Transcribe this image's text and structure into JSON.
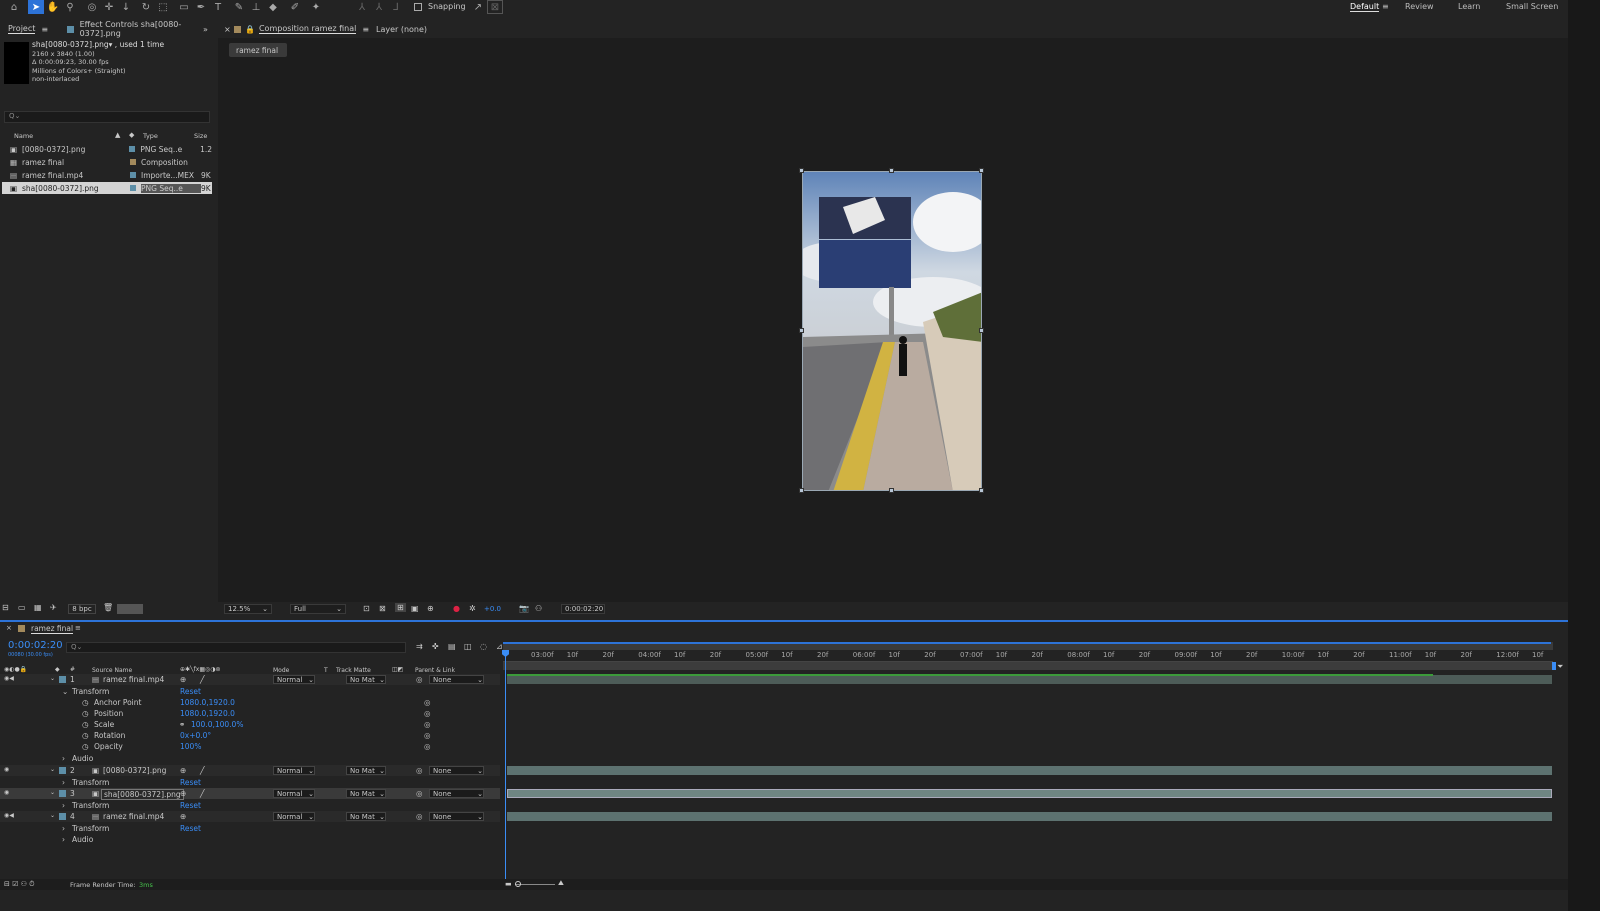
{
  "toolbar": {
    "snapping": "Snapping",
    "workspaces": [
      "Default",
      "Review",
      "Learn",
      "Small Screen"
    ]
  },
  "project_panel": {
    "tab_project": "Project",
    "tab_effect_controls": "Effect Controls sha[0080-0372].png",
    "info_name": "sha[0080-0372].png▾ , used 1 time",
    "info_size": "2160 x 3840 (1.00)",
    "info_dur": "Δ 0:00:09:23, 30.00 fps",
    "info_colors": "Millions of Colors+ (Straight)",
    "info_interlace": "non-interlaced",
    "search_placeholder": "Q⌄",
    "columns": {
      "name": "Name",
      "type": "Type",
      "size": "Size"
    },
    "items": [
      {
        "name": "[0080-0372].png",
        "type": "PNG Seq..e",
        "size": "1.2",
        "color": "#5d8fa8"
      },
      {
        "name": "ramez final",
        "type": "Composition",
        "size": "",
        "color": "#a38a5c"
      },
      {
        "name": "ramez final.mp4",
        "type": "Importe...MEX",
        "size": "9K",
        "color": "#5d8fa8"
      },
      {
        "name": "sha[0080-0372].png",
        "type": "PNG Seq..e",
        "size": "9K",
        "color": "#5d8fa8"
      }
    ],
    "bpc": "8 bpc"
  },
  "viewer": {
    "tab_comp": "Composition ramez final",
    "tab_layer": "Layer (none)",
    "comp_button": "ramez final",
    "zoom": "12.5%",
    "resolution": "Full",
    "exposure": "+0.0",
    "timecode": "0:00:02:20"
  },
  "timeline": {
    "tab": "ramez final",
    "timecode": "0:00:02:20",
    "timecode_sub": "00080 (30.00 fps)",
    "col_source": "Source Name",
    "col_mode": "Mode",
    "col_t": "T",
    "col_trackmatte": "Track Matte",
    "col_parent": "Parent & Link",
    "ruler": [
      "03:00f",
      "10f",
      "20f",
      "04:00f",
      "10f",
      "20f",
      "05:00f",
      "10f",
      "20f",
      "06:00f",
      "10f",
      "20f",
      "07:00f",
      "10f",
      "20f",
      "08:00f",
      "10f",
      "20f",
      "09:00f",
      "10f",
      "20f",
      "10:00f",
      "10f",
      "20f",
      "11:00f",
      "10f",
      "20f",
      "12:00f",
      "10f"
    ],
    "layer1": {
      "num": "1",
      "name": "ramez final.mp4",
      "mode": "Normal",
      "matte": "No Mat",
      "parent": "None"
    },
    "transform": "Transform",
    "reset": "Reset",
    "audio": "Audio",
    "props": [
      {
        "name": "Anchor Point",
        "value": "1080.0,1920.0"
      },
      {
        "name": "Position",
        "value": "1080.0,1920.0"
      },
      {
        "name": "Scale",
        "value": "100.0,100.0%"
      },
      {
        "name": "Rotation",
        "value": "0x+0.0°"
      },
      {
        "name": "Opacity",
        "value": "100%"
      }
    ],
    "layer2": {
      "num": "2",
      "name": "[0080-0372].png",
      "mode": "Normal",
      "matte": "No Mat",
      "parent": "None"
    },
    "layer3": {
      "num": "3",
      "name": "sha[0080-0372].png",
      "mode": "Normal",
      "matte": "No Mat",
      "parent": "None"
    },
    "layer4": {
      "num": "4",
      "name": "ramez final.mp4",
      "mode": "Normal",
      "matte": "No Mat",
      "parent": "None"
    },
    "render_label": "Frame Render Time:",
    "render_value": "3ms"
  }
}
